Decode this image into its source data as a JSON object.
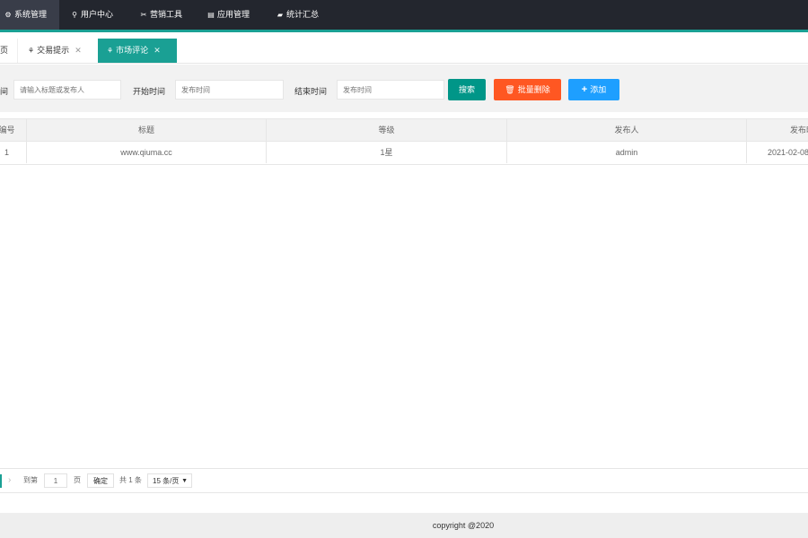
{
  "nav": {
    "items": [
      {
        "label": "系统管理",
        "icon": "gear-icon",
        "glyph": "⚙"
      },
      {
        "label": "用户中心",
        "icon": "user-icon",
        "glyph": "👤"
      },
      {
        "label": "营销工具",
        "icon": "tools-icon",
        "glyph": "✂"
      },
      {
        "label": "应用管理",
        "icon": "app-icon",
        "glyph": "▤"
      },
      {
        "label": "统计汇总",
        "icon": "chat-icon",
        "glyph": "▰"
      }
    ],
    "colors": {
      "bg": "#23262e",
      "active": "#393d49",
      "accent": "#1aa094"
    }
  },
  "tabs": [
    {
      "label": "首页",
      "visible_text": "页"
    },
    {
      "label": "交易提示",
      "icon": "network-icon",
      "glyph": "⚘",
      "close": "✕"
    },
    {
      "label": "市场评论",
      "icon": "network-icon",
      "glyph": "⚘",
      "close": "✕"
    }
  ],
  "search": {
    "field1_label": "间",
    "field1_placeholder": "请输入标题或发布人",
    "start_label": "开始时间",
    "start_placeholder": "发布时间",
    "end_label": "结束时间",
    "end_placeholder": "发布时间",
    "search_button": "搜索",
    "batch_delete_button": "批量删除",
    "add_button": "添加",
    "colors": {
      "search": "#009688",
      "delete": "#ff5722",
      "add": "#1e9fff"
    }
  },
  "table": {
    "headers": [
      "编号",
      "标题",
      "等级",
      "发布人",
      "发布时"
    ],
    "rows": [
      [
        "1",
        "www.qiuma.cc",
        "1星",
        "admin",
        "2021-02-08"
      ]
    ]
  },
  "pagination": {
    "goto_label": "到第",
    "page_value": "1",
    "page_unit": "页",
    "confirm_button": "确定",
    "total": "共 1 条",
    "per_page": "15 条/页"
  },
  "footer": {
    "copyright": "copyright @2020"
  }
}
